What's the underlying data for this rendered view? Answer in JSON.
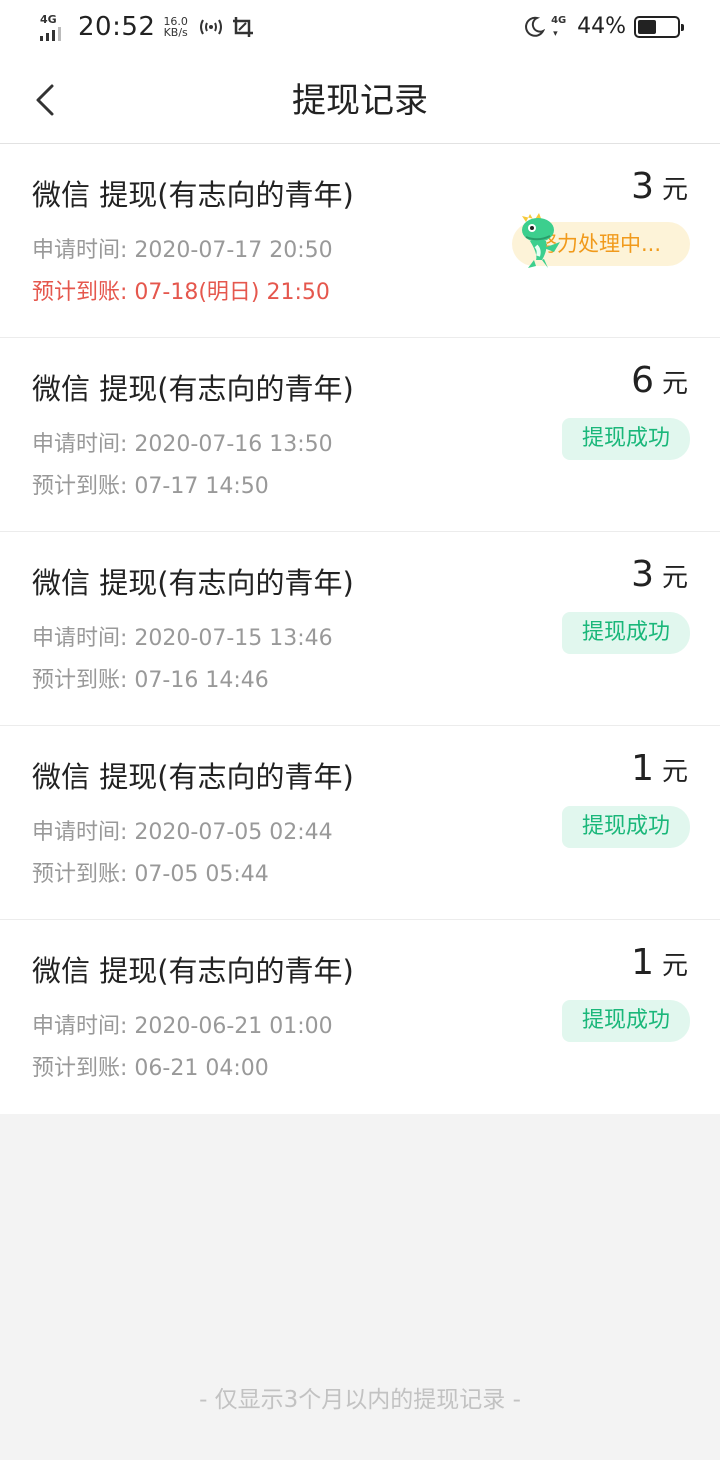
{
  "status_bar": {
    "network": "4G",
    "time": "20:52",
    "speed_value": "16.0",
    "speed_unit": "KB/s",
    "network2": "4G",
    "battery_percent": "44%",
    "battery_level": 0.44
  },
  "header": {
    "title": "提现记录"
  },
  "records": [
    {
      "title": "微信 提现(有志向的青年)",
      "amount": "3",
      "unit": "元",
      "apply_time": "申请时间: 2020-07-17 20:50",
      "expected_arrival": "预计到账: 07-18(明日) 21:50",
      "status": "努力处理中..."
    },
    {
      "title": "微信 提现(有志向的青年)",
      "amount": "6",
      "unit": "元",
      "apply_time": "申请时间: 2020-07-16 13:50",
      "expected_arrival": "预计到账: 07-17 14:50",
      "status": "提现成功"
    },
    {
      "title": "微信 提现(有志向的青年)",
      "amount": "3",
      "unit": "元",
      "apply_time": "申请时间: 2020-07-15 13:46",
      "expected_arrival": "预计到账: 07-16 14:46",
      "status": "提现成功"
    },
    {
      "title": "微信 提现(有志向的青年)",
      "amount": "1",
      "unit": "元",
      "apply_time": "申请时间: 2020-07-05 02:44",
      "expected_arrival": "预计到账: 07-05 05:44",
      "status": "提现成功"
    },
    {
      "title": "微信 提现(有志向的青年)",
      "amount": "1",
      "unit": "元",
      "apply_time": "申请时间: 2020-06-21 01:00",
      "expected_arrival": "预计到账: 06-21 04:00",
      "status": "提现成功"
    }
  ],
  "footer": {
    "note": "- 仅显示3个月以内的提现记录 -"
  },
  "colors": {
    "success_text": "#1ab77a",
    "success_bg": "#e1f7ee",
    "pending_text": "#f19a1b",
    "pending_bg": "#fdf3d8",
    "expected_pending": "#e5574d",
    "mascot": "#3ccf8e"
  },
  "icons": {
    "back": "chevron-left-icon",
    "mascot": "dinosaur-mascot-icon",
    "hotspot": "hotspot-icon",
    "screenshot": "screenshot-icon",
    "moon": "moon-icon"
  }
}
